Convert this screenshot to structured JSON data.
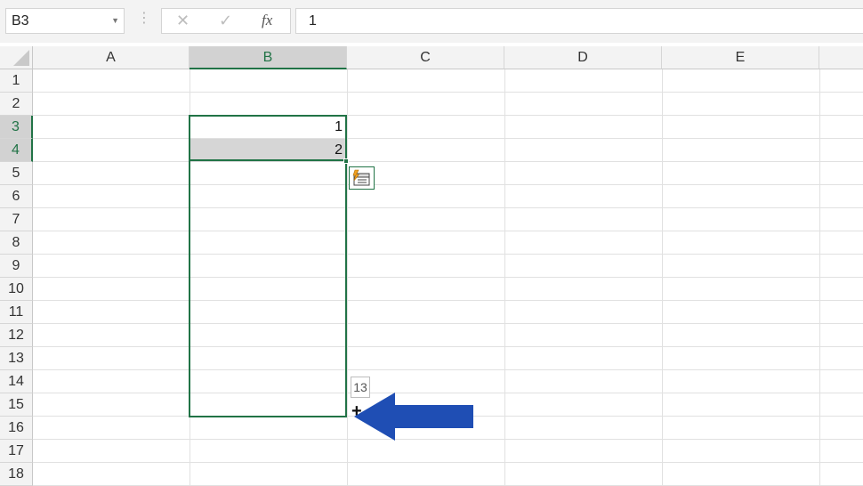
{
  "name_box": {
    "value": "B3"
  },
  "formula_bar": {
    "cancel_icon": "close-icon",
    "enter_icon": "check-icon",
    "fx_label": "fx",
    "value": "1"
  },
  "columns": [
    "A",
    "B",
    "C",
    "D",
    "E"
  ],
  "rows": [
    "1",
    "2",
    "3",
    "4",
    "5",
    "6",
    "7",
    "8",
    "9",
    "10",
    "11",
    "12",
    "13",
    "14",
    "15",
    "16",
    "17",
    "18"
  ],
  "cells": {
    "B3": "1",
    "B4": "2"
  },
  "autofill_tooltip": "13",
  "fill_cursor": "+",
  "colors": {
    "accent": "#217346",
    "arrow": "#1f4eb4",
    "selection_fill": "#d6d6d6"
  }
}
